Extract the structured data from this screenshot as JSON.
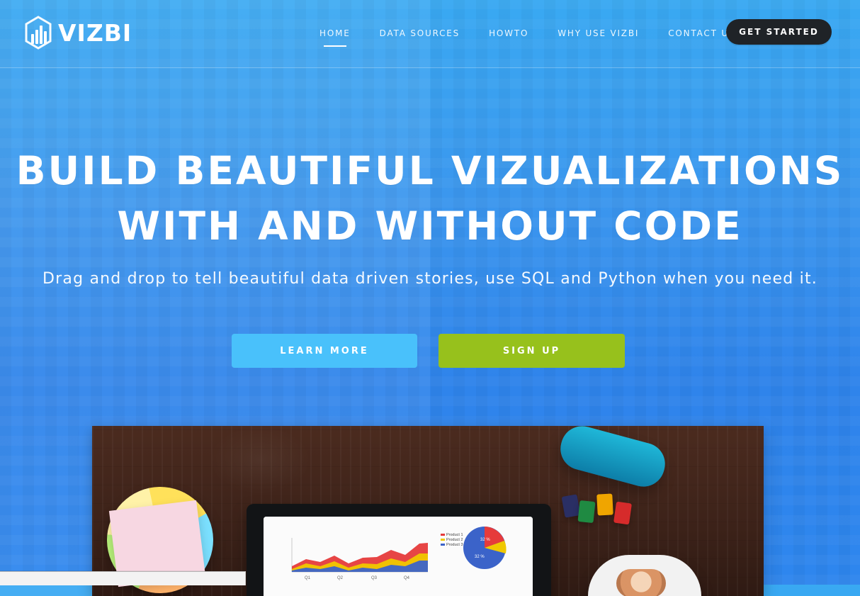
{
  "brand": {
    "name": "VIZBI",
    "logo_icon": "bar-chart-hexagon-icon"
  },
  "nav": {
    "items": [
      {
        "label": "HOME",
        "active": true
      },
      {
        "label": "DATA SOURCES",
        "active": false
      },
      {
        "label": "HOWTO",
        "active": false
      },
      {
        "label": "WHY USE VIZBI",
        "active": false
      },
      {
        "label": "CONTACT US",
        "active": false
      }
    ],
    "cta_label": "GET STARTED"
  },
  "hero": {
    "title_line1": "BUILD BEAUTIFUL VIZUALIZATIONS",
    "title_line2": "WITH AND WITHOUT CODE",
    "subtitle": "Drag and drop to tell beautiful data driven stories, use SQL and Python when you need it.",
    "buttons": {
      "learn_more": "LEARN MORE",
      "sign_up": "SIGN UP"
    }
  },
  "colors": {
    "bg_top": "#39a9f2",
    "bg_bottom": "#2e86ee",
    "cta_dark": "#1f2327",
    "learn_more": "#49c1fb",
    "sign_up": "#97c11c"
  },
  "image": {
    "semantic": "desk-with-laptop-dashboard-photo",
    "screen_chart": {
      "legend": [
        "Product 1",
        "Product 2",
        "Product 3"
      ],
      "x_labels": [
        "Q1",
        "Q2",
        "Q3",
        "Q4"
      ],
      "pie_labels": [
        "32 %",
        "32 %"
      ]
    }
  }
}
